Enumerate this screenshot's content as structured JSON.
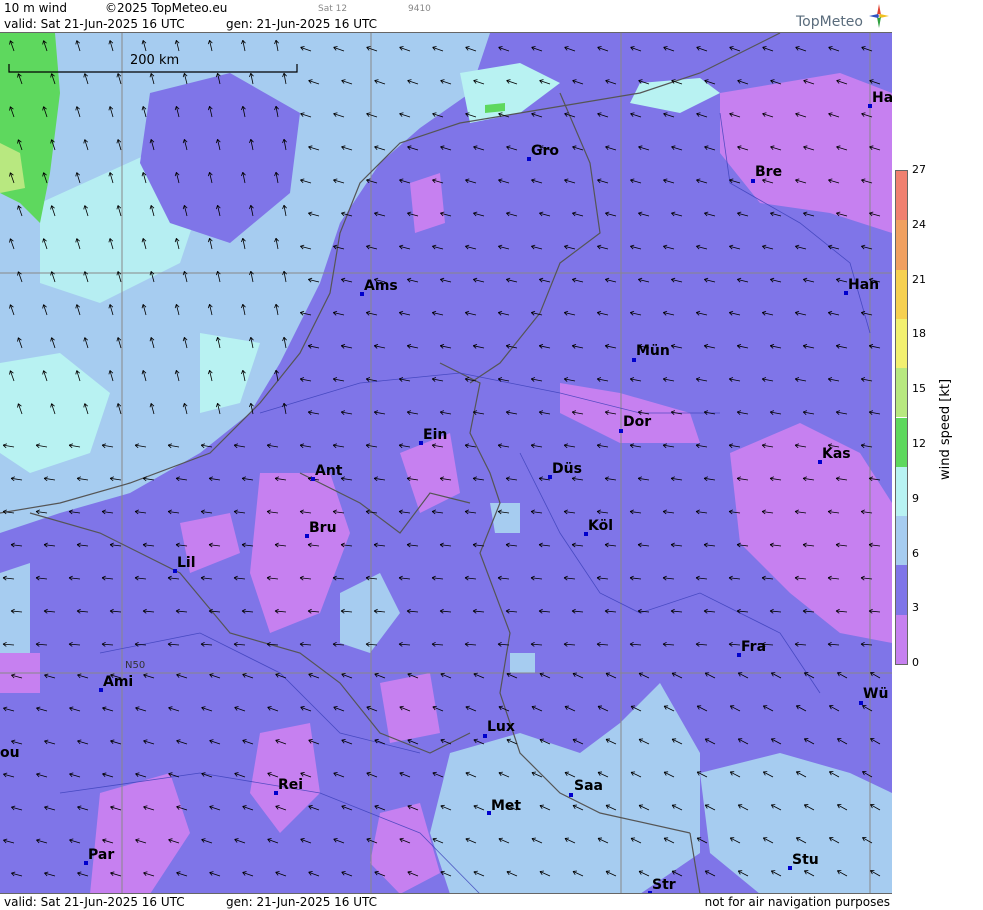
{
  "header": {
    "title": "10 m wind",
    "copyright": "©2025 TopMeteo.eu",
    "sat_label": "Sat 12",
    "code": "9410",
    "valid": "valid:  Sat  21-Jun-2025  16 UTC",
    "gen": "gen: 21-Jun-2025 16 UTC"
  },
  "footer": {
    "valid": "valid:  Sat  21-Jun-2025  16 UTC",
    "gen": "gen: 21-Jun-2025 16 UTC",
    "disclaimer": "not for air navigation purposes"
  },
  "logo": {
    "text": "TopMeteo"
  },
  "map": {
    "scale_label": "200 km",
    "lat_label": "N50",
    "cities": [
      "Ha",
      "Gro",
      "Bre",
      "Ams",
      "Han",
      "Mün",
      "Dor",
      "Ein",
      "Kas",
      "Düs",
      "Ant",
      "Köl",
      "Bru",
      "Lil",
      "Fra",
      "Ami",
      "Wü",
      "Lux",
      "ou",
      "Saa",
      "Rei",
      "Met",
      "Par",
      "Stu",
      "Str"
    ]
  },
  "legend": {
    "title": "wind speed [kt]",
    "ticks": [
      "27",
      "24",
      "21",
      "18",
      "15",
      "12",
      "9",
      "6",
      "3",
      "0"
    ],
    "colors": [
      "#f08070",
      "#f0a060",
      "#f6d050",
      "#f2f070",
      "#b8e880",
      "#5ed85e",
      "#b8f2f2",
      "#a6ccf0",
      "#7f75e8",
      "#c680f0"
    ]
  }
}
